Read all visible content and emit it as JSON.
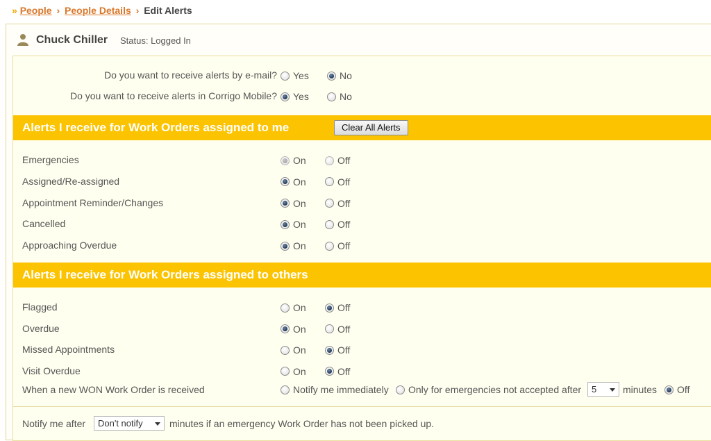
{
  "breadcrumb": {
    "chevron": "»",
    "items": [
      "People",
      "People Details"
    ],
    "separator": "›",
    "current": "Edit Alerts"
  },
  "user": {
    "name": "Chuck Chiller",
    "status": "Status: Logged In",
    "icon": "user-icon"
  },
  "contact_prefs": [
    {
      "question": "Do you want to receive alerts by e-mail?",
      "options": [
        "Yes",
        "No"
      ],
      "selected": "No"
    },
    {
      "question": "Do you want to receive alerts in Corrigo Mobile?",
      "options": [
        "Yes",
        "No"
      ],
      "selected": "Yes"
    }
  ],
  "section_assigned_me": {
    "title": "Alerts I receive for Work Orders assigned to me",
    "clear_button": "Clear All Alerts",
    "rows": [
      {
        "label": "Emergencies",
        "on": "On",
        "off": "Off",
        "selected": "On",
        "disabled": true
      },
      {
        "label": "Assigned/Re-assigned",
        "on": "On",
        "off": "Off",
        "selected": "On",
        "disabled": false
      },
      {
        "label": "Appointment Reminder/Changes",
        "on": "On",
        "off": "Off",
        "selected": "On",
        "disabled": false
      },
      {
        "label": "Cancelled",
        "on": "On",
        "off": "Off",
        "selected": "On",
        "disabled": false
      },
      {
        "label": "Approaching Overdue",
        "on": "On",
        "off": "Off",
        "selected": "On",
        "disabled": false
      }
    ]
  },
  "section_assigned_others": {
    "title": "Alerts I receive for Work Orders assigned to others",
    "rows": [
      {
        "label": "Flagged",
        "on": "On",
        "off": "Off",
        "selected": "Off"
      },
      {
        "label": "Overdue",
        "on": "On",
        "off": "Off",
        "selected": "On"
      },
      {
        "label": "Missed Appointments",
        "on": "On",
        "off": "Off",
        "selected": "Off"
      },
      {
        "label": "Visit Overdue",
        "on": "On",
        "off": "Off",
        "selected": "Off"
      }
    ]
  },
  "won": {
    "label": "When a new WON Work Order is received",
    "opt_immediate": "Notify me immediately",
    "opt_emergencies": "Only for emergencies not accepted after",
    "minutes_value": "5",
    "minutes_label": "minutes",
    "opt_off": "Off",
    "selected": "Off"
  },
  "notify": {
    "prefix": "Notify me after",
    "select_value": "Don't notify",
    "suffix": "minutes if an emergency Work Order has not been picked up."
  },
  "colors": {
    "section_bar": "#fcc300",
    "breadcrumb_link": "#d9772a",
    "chevron": "#f0a800"
  }
}
